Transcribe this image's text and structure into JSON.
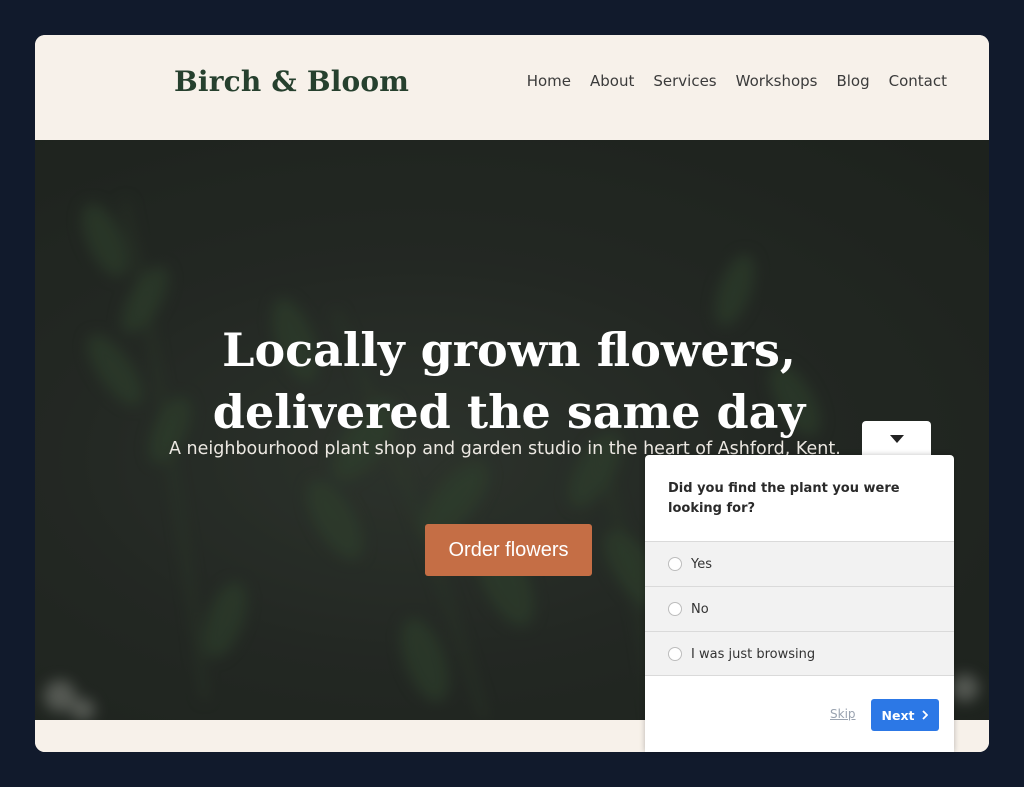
{
  "site": {
    "logo": "Birch & Bloom",
    "nav": [
      "Home",
      "About",
      "Services",
      "Workshops",
      "Blog",
      "Contact"
    ]
  },
  "hero": {
    "title_line1": "Locally grown flowers,",
    "title_line2": "delivered the same day",
    "subtitle": "A neighbourhood plant shop and garden studio in the heart of Ashford, Kent.",
    "cta_label": "Order flowers"
  },
  "survey": {
    "toggle_icon": "caret-down-icon",
    "question": "Did you find the plant you were looking for?",
    "options": [
      "Yes",
      "No",
      "I was just browsing"
    ],
    "skip_label": "Skip",
    "next_label": "Next",
    "next_color": "#2c78e6"
  },
  "colors": {
    "accent": "#c56e45",
    "brand": "#26402e",
    "cream": "#f7f1ea"
  }
}
